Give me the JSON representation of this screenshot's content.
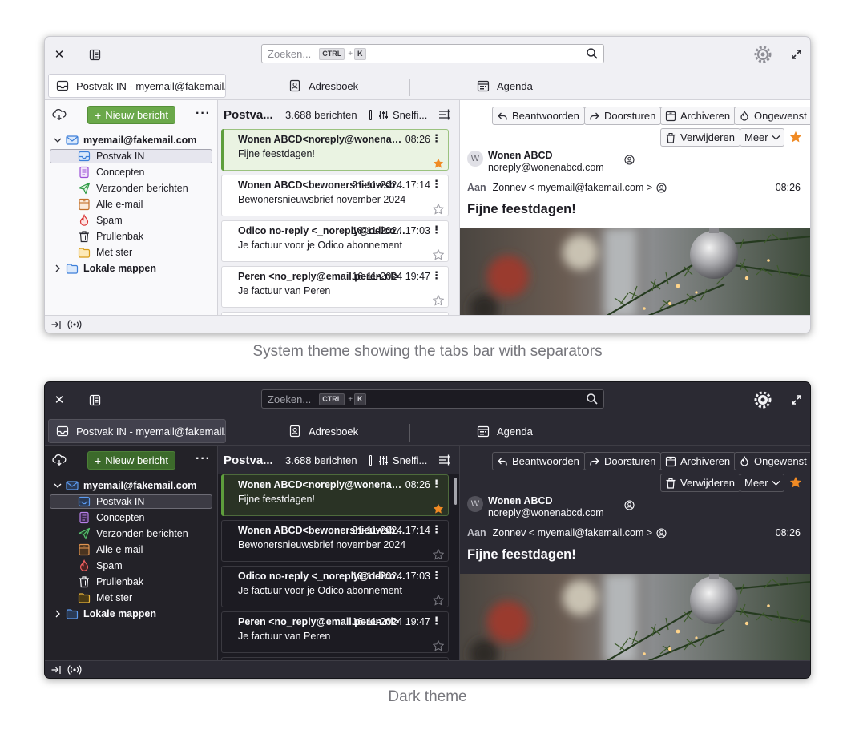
{
  "windows": {
    "light": {
      "caption": "System theme showing the tabs bar with separators"
    },
    "dark": {
      "caption": "Dark theme"
    }
  },
  "titlebar": {
    "search_placeholder": "Zoeken...",
    "kbd_ctrl": "CTRL",
    "kbd_plus": "+",
    "kbd_k": "K"
  },
  "tabs": [
    {
      "label": "Postvak IN - myemail@fakemail.com"
    },
    {
      "label": "Adresboek"
    },
    {
      "label": "Agenda"
    }
  ],
  "folders": {
    "new_message": "Nieuw bericht",
    "more": "···",
    "account": "myemail@fakemail.com",
    "items": [
      {
        "label": "Postvak IN",
        "icon": "inbox-icon"
      },
      {
        "label": "Concepten",
        "icon": "drafts-icon"
      },
      {
        "label": "Verzonden berichten",
        "icon": "sent-icon"
      },
      {
        "label": "Alle e-mail",
        "icon": "archive-icon"
      },
      {
        "label": "Spam",
        "icon": "spam-icon"
      },
      {
        "label": "Prullenbak",
        "icon": "trash-icon"
      },
      {
        "label": "Met ster",
        "icon": "starred-folder-icon"
      }
    ],
    "local": "Lokale mappen"
  },
  "message_list": {
    "title": "Postva...",
    "count": "3.688 berichten",
    "quickfilter": "Snelfi...",
    "messages": [
      {
        "from": "Wonen ABCD<noreply@wonenabcd.com>",
        "date": "08:26",
        "subject": "Fijne feestdagen!",
        "starred": true
      },
      {
        "from": "Wonen ABCD<bewonersnieuwsbrief@wonenabcd.com>",
        "date": "21-11-2024 17:14",
        "subject": "Bewonersnieuwsbrief november 2024",
        "starred": false
      },
      {
        "from": "Odico no-reply <_noreply@odico.nl>",
        "date": "18-11-2024 17:03",
        "subject": "Je factuur voor je Odico abonnement",
        "starred": false
      },
      {
        "from": "Peren <no_reply@email.peren.nl>",
        "date": "16-11-2024 19:47",
        "subject": "Je factuur van Peren",
        "starred": false
      }
    ]
  },
  "reader": {
    "reply": "Beantwoorden",
    "forward": "Doorsturen",
    "archive": "Archiveren",
    "junk": "Ongewenst",
    "delete": "Verwijderen",
    "more": "Meer",
    "avatar_letter": "W",
    "from_name": "Wonen ABCD",
    "from_addr": "noreply@wonenabcd.com",
    "to_label": "Aan",
    "to_value": "Zonnev < myemail@fakemail.com >",
    "time": "08:26",
    "subject": "Fijne feestdagen!"
  },
  "colors": {
    "accent_green": "#5e9e3c",
    "star_orange": "#f08a24"
  }
}
